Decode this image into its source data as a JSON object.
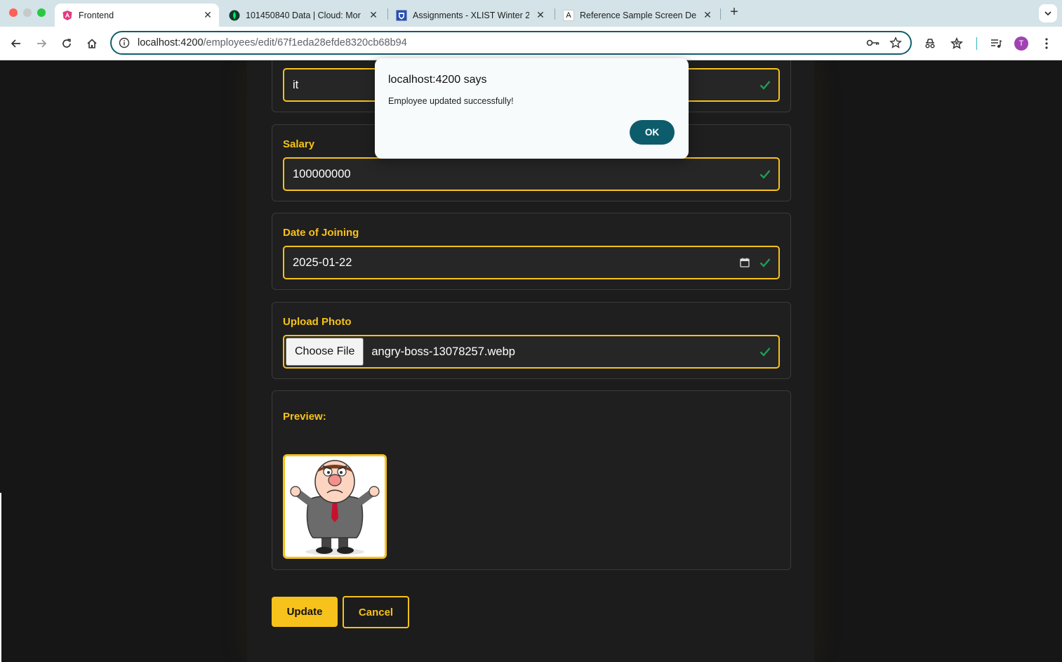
{
  "browser": {
    "tabs": [
      {
        "title": "Frontend",
        "favicon": "angular-icon"
      },
      {
        "title": "101450840 Data | Cloud: Mor",
        "favicon": "mongodb-leaf-icon"
      },
      {
        "title": "Assignments - XLIST Winter 2",
        "favicon": "college-crest-icon"
      },
      {
        "title": "Reference Sample Screen De",
        "favicon": "letter-a-icon",
        "favicon_text": "A"
      }
    ],
    "url_host": "localhost:4200",
    "url_path": "/employees/edit/67f1eda28efde8320cb68b94",
    "avatar_letter": "T"
  },
  "form": {
    "department_value": "it",
    "salary": {
      "label": "Salary",
      "value": "100000000"
    },
    "date_of_joining": {
      "label": "Date of Joining",
      "value": "2025-01-22"
    },
    "upload_photo": {
      "label": "Upload Photo",
      "button": "Choose File",
      "file_name": "angry-boss-13078257.webp"
    },
    "preview": {
      "label": "Preview:"
    },
    "update_label": "Update",
    "cancel_label": "Cancel"
  },
  "dialog": {
    "title": "localhost:4200 says",
    "message": "Employee updated successfully!",
    "ok_label": "OK"
  },
  "colors": {
    "accent": "#f7c21b",
    "success_check": "#1f9d55",
    "dialog_button": "#0d5c6c"
  }
}
